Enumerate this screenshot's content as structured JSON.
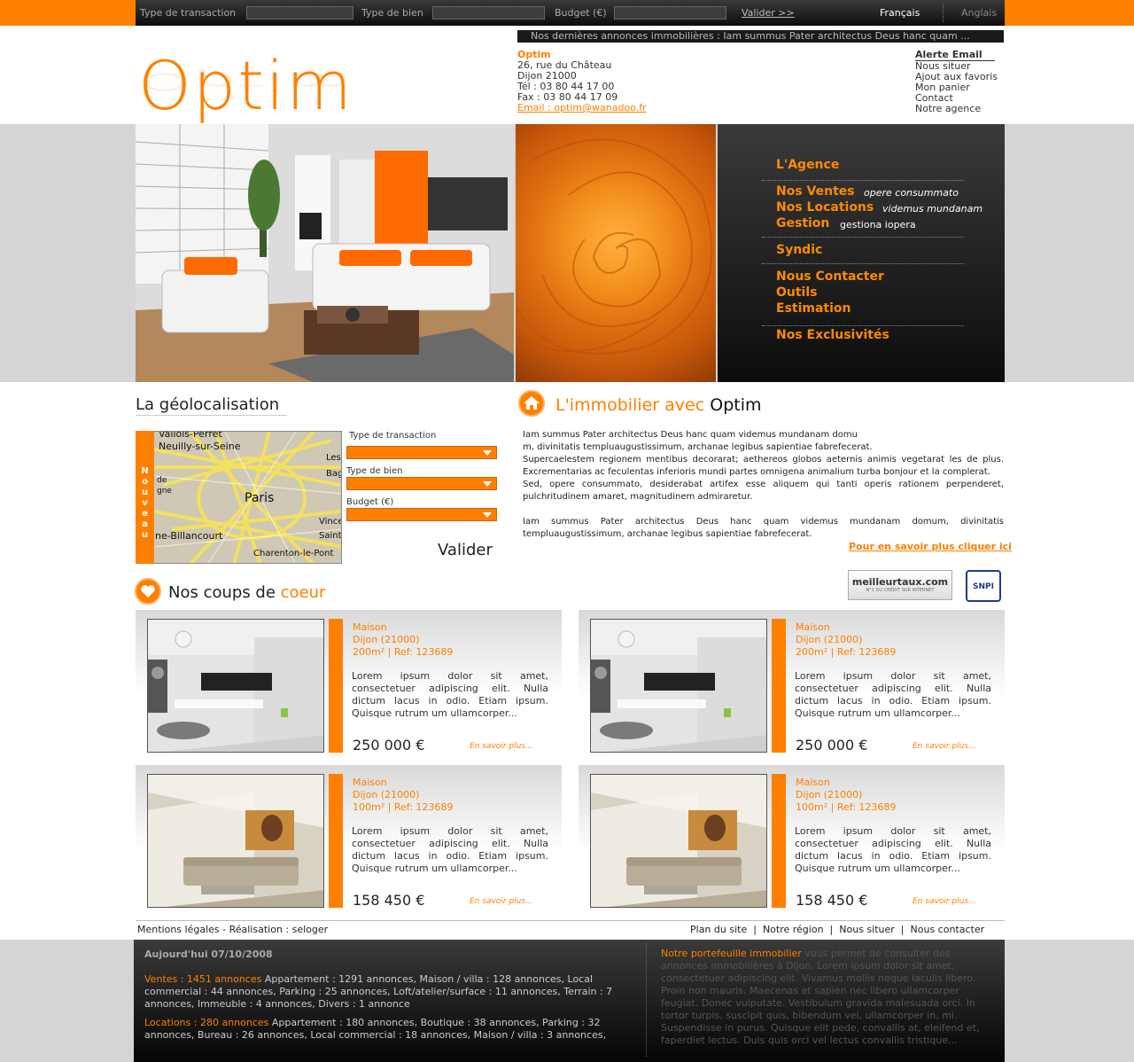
{
  "topbar": {
    "transaction_label": "Type de transaction",
    "bien_label": "Type de bien",
    "budget_label": "Budget (€)",
    "valider": "Valider >>",
    "lang_fr": "Français",
    "lang_en": "Anglais"
  },
  "brand": {
    "logo": "Optim"
  },
  "ticker": "Nos dernières annonces immobilières  : Iam summus Pater architectus Deus hanc quam  ...",
  "contact": {
    "name": "Optim",
    "address1": "26, rue du Château",
    "address2": "Dijon 21000",
    "tel": "Tél : 03 80 44 17 00",
    "fax": "Fax : 03 80 44 17 09",
    "email": "Email : optim@wanadoo.fr"
  },
  "rightlinks": {
    "alert": "Alerte Email",
    "l1": "Nous situer",
    "l2": "Ajout aux favoris",
    "l3": "Mon panier",
    "l4": "Contact",
    "l5": "Notre agence"
  },
  "menu": {
    "agence": "L'Agence",
    "ventes": "Nos Ventes",
    "ventes_sub": "opere consummato",
    "locations": "Nos Locations",
    "locations_sub": "videmus mundanam",
    "gestion": "Gestion",
    "gestion_sub": "gestiona iopera",
    "syndic": "Syndic",
    "contacter": "Nous Contacter",
    "outils": "Outils",
    "estimation": "Estimation",
    "exclusivites": "Nos Exclusivités"
  },
  "geo": {
    "title": "La géolocalisation",
    "side": "Nouveau",
    "transaction": "Type de transaction",
    "bien": "Type de bien",
    "budget": "Budget (€)",
    "valider": "Valider",
    "map_labels": {
      "a": "Vallois-Perret",
      "b": "Neuilly-sur-Seine",
      "c": "Paris",
      "d": "ne-Billancourt",
      "e": "Charenton-le-Pont",
      "f": "Les",
      "g": "Bag",
      "h": "Vince",
      "i": "Saint",
      "j": "de",
      "k": "gne"
    }
  },
  "immo": {
    "title_orange": "L'immobilier avec",
    "title_black": "Optim",
    "p1": "Iam summus Pater architectus Deus hanc quam videmus mundanam domu",
    "p2": "m, divinitatis templuaugustissimum, archanae legibus sapientiae fabrefecerat.",
    "p3": "Supercaelestem regionem mentibus decorarat; aethereos globos aeternis animis vegetarat les de plus. Excrementarias ac feculentas inferioris mundi partes omnigena animalium turba bonjour et la complerat.",
    "p4": "Sed, opere consummato, desiderabat artifex esse aliquem qui tanti operis rationem perpenderet, pulchritudinem amaret, magnitudinem admiraretur.",
    "p5": "Iam summus Pater architectus Deus hanc quam videmus mundanam domum, divinitatis templuaugustissimum, archanae legibus sapientiae fabrefecerat.",
    "more": "Pour en savoir plus cliquer ici"
  },
  "partners": {
    "mt": "meilleurtaux.com",
    "mt_sub": "N°1 DU CRÉDIT SUR INTERNET",
    "snpi": "SNPI"
  },
  "coups": {
    "title": "Nos coups de",
    "title_orange": "coeur"
  },
  "cards": [
    {
      "type": "Maison",
      "city": "Dijon (21000)",
      "info": "200m² | Ref: 123689",
      "desc": "Lorem ipsum dolor sit amet, consectetuer adipiscing elit. Nulla dictum lacus in odio. Etiam ipsum. Quisque rutrum um ullamcorper...",
      "price": "250 000 €",
      "more": "En savoir plus..."
    },
    {
      "type": "Maison",
      "city": "Dijon (21000)",
      "info": "200m² | Ref: 123689",
      "desc": "Lorem ipsum dolor sit amet, consectetuer adipiscing elit. Nulla dictum lacus in odio. Etiam ipsum. Quisque rutrum um ullamcorper...",
      "price": "250 000 €",
      "more": "En savoir plus..."
    },
    {
      "type": "Maison",
      "city": "Dijon (21000)",
      "info": "100m² | Ref: 123689",
      "desc": "Lorem ipsum dolor sit amet, consectetuer adipiscing elit. Nulla dictum lacus in odio. Etiam ipsum. Quisque rutrum um ullamcorper...",
      "price": "158 450 €",
      "more": "En savoir plus..."
    },
    {
      "type": "Maison",
      "city": "Dijon (21000)",
      "info": "100m² | Ref: 123689",
      "desc": "Lorem ipsum dolor sit amet, consectetuer adipiscing elit. Nulla dictum lacus in odio. Etiam ipsum. Quisque rutrum um ullamcorper...",
      "price": "158 450 €",
      "more": "En savoir plus..."
    }
  ],
  "footer": {
    "left": "Mentions légales - Réalisation : seloger",
    "plan": "Plan du site",
    "region": "Notre région",
    "situer": "Nous situer",
    "contacter": "Nous contacter",
    "sep": "|"
  },
  "bottom": {
    "date": "Aujourd'hui 07/10/2008",
    "ventes_label": "Ventes : 1451 annonces",
    "ventes_text": " Appartement : 1291 annonces, Maison / villa : 128 annonces, Local commercial : 44 annonces, Parking : 25 annonces, Loft/atelier/surface : 11 annonces, Terrain : 7 annonces, Immeuble : 4 annonces, Divers : 1 annonce",
    "loc_label": "Locations : 280 annonces",
    "loc_text": " Appartement : 180 annonces, Boutique : 38 annonces, Parking : 32 annonces, Bureau : 26 annonces, Local commercial : 18 annonces, Maison / villa : 3 annonces,",
    "right_label": "Notre portefeuille immobilier",
    "right_text": " vous permet de consulter des annonces immobilières à Dijon. Lorem ipsum dolor sit amet, consectetuer adipiscing elit. Vivamus mollis neque iaculis libero. Proin non mauris. Maecenas et sapien nec libero ullamcorper feugiat. Donec vulputate. Vestibulum gravida malesuada orci. In tortor turpis, suscipit quis, bibendum vel, ullamcorper in, mi. Suspendisse in purus. Quisque elit pede, convallis at, eleifend et, faperdiet lectus. Duis quis orci vel lectus convallis tristique..."
  },
  "colors": {
    "accent": "#ff7f00",
    "dark": "#1a1a1a",
    "band": "#d5d5d5"
  }
}
